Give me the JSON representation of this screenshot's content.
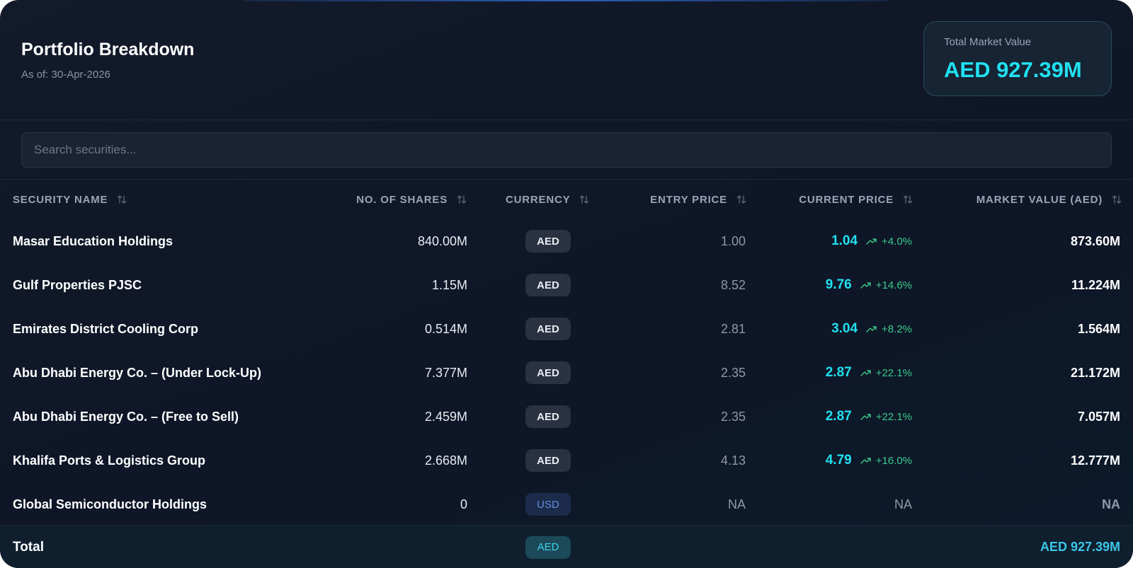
{
  "header": {
    "title": "Portfolio Breakdown",
    "as_of": "As of: 30-Apr-2026",
    "total_market_value_label": "Total Market Value",
    "total_market_value": "AED 927.39M"
  },
  "search": {
    "placeholder": "Search securities...",
    "value": ""
  },
  "table": {
    "columns": {
      "security_name": "SECURITY NAME",
      "shares": "NO. OF SHARES",
      "currency": "CURRENCY",
      "entry_price": "ENTRY PRICE",
      "current_price": "CURRENT PRICE",
      "market_value": "MARKET VALUE (AED)"
    },
    "rows": [
      {
        "name": "Masar Education Holdings",
        "shares": "840.00M",
        "currency": "AED",
        "entry_price": "1.00",
        "current_price": "1.04",
        "change": "+4.0%",
        "market_value": "873.60M"
      },
      {
        "name": "Gulf Properties PJSC",
        "shares": "1.15M",
        "currency": "AED",
        "entry_price": "8.52",
        "current_price": "9.76",
        "change": "+14.6%",
        "market_value": "11.224M"
      },
      {
        "name": "Emirates District Cooling Corp",
        "shares": "0.514M",
        "currency": "AED",
        "entry_price": "2.81",
        "current_price": "3.04",
        "change": "+8.2%",
        "market_value": "1.564M"
      },
      {
        "name": "Abu Dhabi Energy Co. – (Under Lock-Up)",
        "shares": "7.377M",
        "currency": "AED",
        "entry_price": "2.35",
        "current_price": "2.87",
        "change": "+22.1%",
        "market_value": "21.172M"
      },
      {
        "name": "Abu Dhabi Energy Co. – (Free to Sell)",
        "shares": "2.459M",
        "currency": "AED",
        "entry_price": "2.35",
        "current_price": "2.87",
        "change": "+22.1%",
        "market_value": "7.057M"
      },
      {
        "name": "Khalifa Ports & Logistics Group",
        "shares": "2.668M",
        "currency": "AED",
        "entry_price": "4.13",
        "current_price": "4.79",
        "change": "+16.0%",
        "market_value": "12.777M"
      },
      {
        "name": "Global Semiconductor Holdings",
        "shares": "0",
        "currency": "USD",
        "entry_price": "NA",
        "current_price": "NA",
        "change": "",
        "market_value": "NA"
      }
    ],
    "total": {
      "label": "Total",
      "currency": "AED",
      "market_value": "AED 927.39M"
    }
  },
  "icons": {
    "sort": "sort-arrows-icon",
    "trend": "trend-up-icon"
  },
  "colors": {
    "accent": "#21e0f0",
    "positive": "#3cc98a",
    "background": "#0e1627"
  }
}
